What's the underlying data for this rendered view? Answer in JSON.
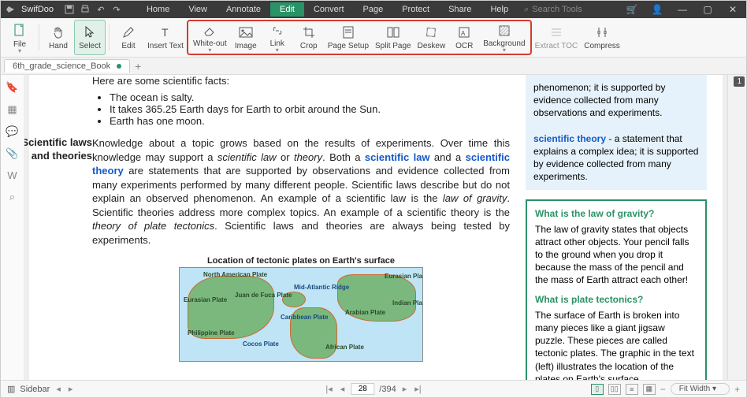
{
  "app": {
    "name": "SwifDoo"
  },
  "menu": [
    "Home",
    "View",
    "Annotate",
    "Edit",
    "Convert",
    "Page",
    "Protect",
    "Share",
    "Help"
  ],
  "menu_active_index": 3,
  "search_placeholder": "Search Tools",
  "ribbon": {
    "file": "File",
    "hand": "Hand",
    "select": "Select",
    "edit": "Edit",
    "insert_text": "Insert Text",
    "whiteout": "White-out",
    "image": "Image",
    "link": "Link",
    "crop": "Crop",
    "page_setup": "Page Setup",
    "split_page": "Split Page",
    "deskew": "Deskew",
    "ocr": "OCR",
    "background": "Background",
    "extract_toc": "Extract TOC",
    "compress": "Compress"
  },
  "tab": {
    "name": "6th_grade_science_Book"
  },
  "page_badge": "1",
  "doc": {
    "intro": "Here are some scientific facts:",
    "facts": [
      "The ocean is salty.",
      "It takes 365.25 Earth days for Earth to orbit around the Sun.",
      "Earth has one moon."
    ],
    "side_heading_1": "Scientific laws",
    "side_heading_2": "and theories",
    "para_parts": {
      "t1": "Knowledge about a topic grows based on the results of experiments. Over time this knowledge may support a ",
      "i1": "scientific law",
      "t2": " or ",
      "i2": "theory",
      "t3": ". Both a ",
      "l1": "scientific law",
      "t4": " and a ",
      "l2": "scientific theory",
      "t5": " are statements that are supported by observations and evidence collected from many experiments performed by many different people. Scientific laws describe but do not explain an observed phenomenon. An example of a scientific law is the ",
      "i3": "law of gravity",
      "t6": ". Scientific theories address more complex topics. An example of a scientific theory is the ",
      "i4": "theory of plate tectonics",
      "t7": ". Scientific laws and theories are always being tested by experiments."
    },
    "map_title": "Location of tectonic plates on Earth's surface",
    "map_labels": [
      "North American Plate",
      "Eurasian Plate",
      "Juan de Fuca Plate",
      "Mid-Atlantic Ridge",
      "Eurasian Plate",
      "Caribbean Plate",
      "Arabian Plate",
      "Indian Plate",
      "Philippine Plate",
      "Cocos Plate",
      "African Plate"
    ]
  },
  "box1": {
    "t1": "phenomenon; it is supported by evidence collected from many observations and experiments.",
    "l1": "scientific theory",
    "t2": " - a statement that explains a complex idea; it is supported by evidence collected from many experiments."
  },
  "box2": {
    "q1": "What is the law of gravity?",
    "p1": "The law of gravity states that objects attract other objects. Your pencil falls to the ground when you drop it because the mass of the pencil and the mass of Earth attract each other!",
    "q2": "What is plate tectonics?",
    "p2": "The surface of Earth is broken into many pieces like a giant jigsaw puzzle. These pieces are called tectonic plates. The graphic in the text (left) illustrates the location of the plates on Earth's surface."
  },
  "status": {
    "sidebar": "Sidebar",
    "page": "28",
    "total": "/394",
    "zoom": "Fit Width"
  }
}
